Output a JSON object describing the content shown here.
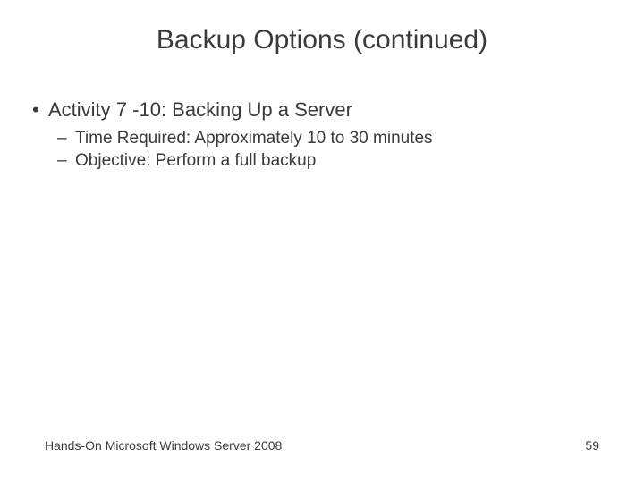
{
  "title": "Backup Options (continued)",
  "bullets": {
    "level1": {
      "marker": "•",
      "text": "Activity 7 -10: Backing Up a Server"
    },
    "level2a": {
      "marker": "–",
      "text": "Time Required: Approximately 10 to 30 minutes"
    },
    "level2b": {
      "marker": "–",
      "text": "Objective: Perform a full backup"
    }
  },
  "footer": {
    "left": "Hands-On Microsoft Windows Server 2008",
    "right": "59"
  }
}
